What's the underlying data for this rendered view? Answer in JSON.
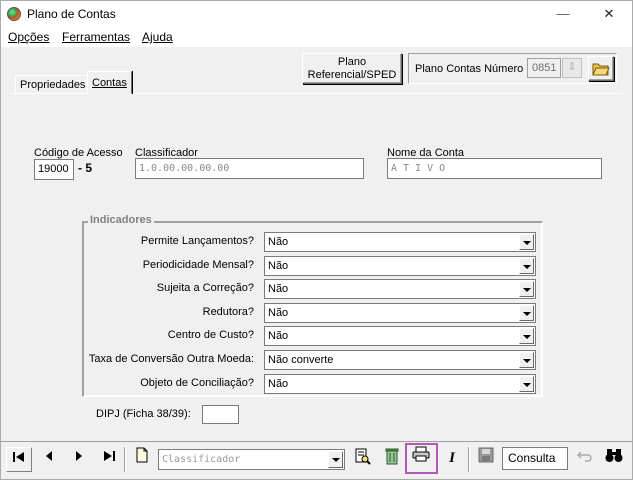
{
  "window": {
    "title": "Plano de Contas",
    "minimize": "—",
    "maximize": "☐",
    "close": "✕"
  },
  "menu": {
    "items": [
      "Opções",
      "Ferramentas",
      "Ajuda"
    ]
  },
  "toolbar_top": {
    "plano_ref_line1": "Plano",
    "plano_ref_line2": "Referencial/SPED",
    "plano_label": "Plano Contas Número",
    "plano_number": "0851"
  },
  "tabs": [
    "Propriedades",
    "Contas"
  ],
  "form": {
    "codigo_label": "Código de Acesso",
    "codigo_value": "19000",
    "codigo_suffix": "- 5",
    "classificador_label": "Classificador",
    "classificador_value": "1.0.00.00.00.00",
    "nome_label": "Nome da Conta",
    "nome_value": "A T I V O",
    "dipj_label": "DIPJ (Ficha 38/39):",
    "dipj_value": ""
  },
  "indicadores": {
    "title": "Indicadores",
    "rows": [
      {
        "label": "Permite Lançamentos?",
        "value": "Não"
      },
      {
        "label": "Periodicidade Mensal?",
        "value": "Não"
      },
      {
        "label": "Sujeita a Correção?",
        "value": "Não"
      },
      {
        "label": "Redutora?",
        "value": "Não"
      },
      {
        "label": "Centro de Custo?",
        "value": "Não"
      },
      {
        "label": "Taxa de Conversão Outra Moeda:",
        "value": "Não converte"
      },
      {
        "label": "Objeto de Conciliação?",
        "value": "Não"
      }
    ]
  },
  "bottom": {
    "classificador_placeholder": "Classificador",
    "mode": "Consulta"
  }
}
